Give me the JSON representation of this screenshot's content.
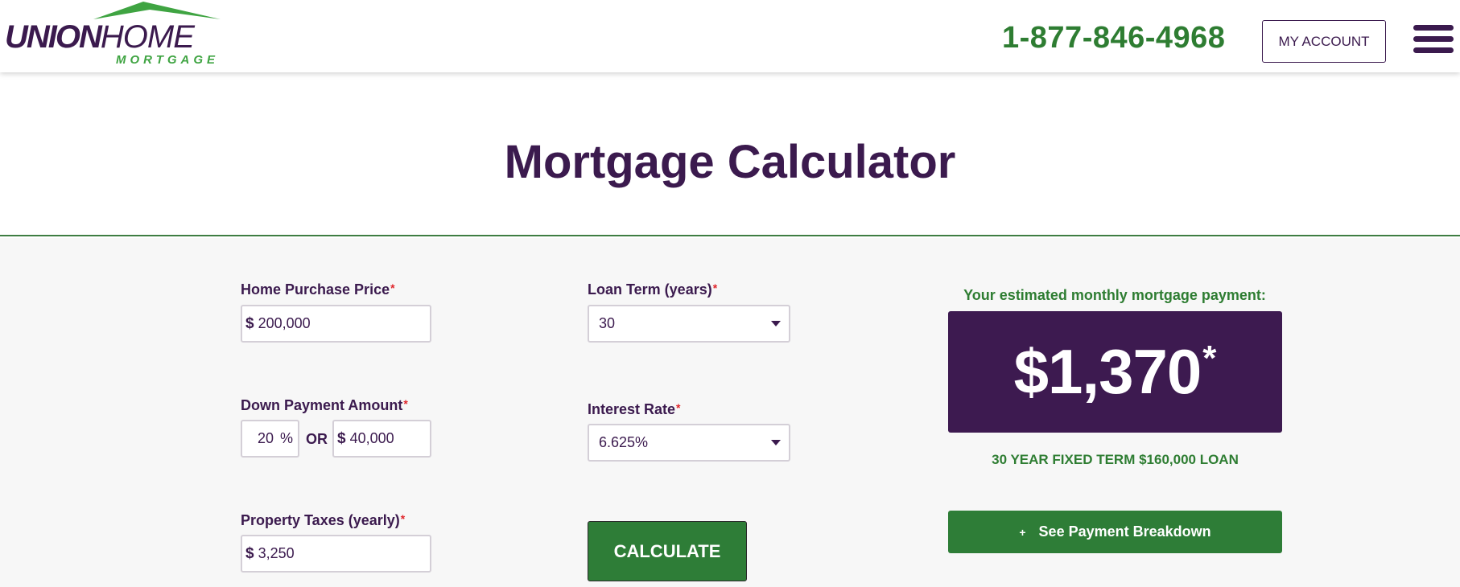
{
  "header": {
    "logo": {
      "word1": "UNION",
      "word2": "HOME",
      "tagline": "MORTGAGE",
      "roof_color": "#3fa442"
    },
    "phone": "1-877-846-4968",
    "account_button": "MY ACCOUNT",
    "menu_icon": "hamburger-icon"
  },
  "page": {
    "title": "Mortgage Calculator"
  },
  "form": {
    "home_price": {
      "label": "Home Purchase Price",
      "required": "*",
      "prefix": "$",
      "value": "200,000"
    },
    "down_payment": {
      "label": "Down Payment Amount",
      "required": "*",
      "percent_value": "20",
      "percent_suffix": "%",
      "or_label": "OR",
      "prefix": "$",
      "amount_value": "40,000"
    },
    "property_taxes": {
      "label": "Property Taxes (yearly)",
      "required": "*",
      "prefix": "$",
      "value": "3,250"
    },
    "loan_term": {
      "label": "Loan Term (years)",
      "required": "*",
      "selected": "30"
    },
    "interest_rate": {
      "label": "Interest Rate",
      "required": "*",
      "selected": "6.625%"
    },
    "calculate_button": "CALCULATE"
  },
  "result": {
    "caption": "Your estimated monthly mortgage payment:",
    "amount": "$1,370",
    "asterisk": "*",
    "summary": "30 YEAR FIXED TERM $160,000 LOAN",
    "breakdown_button": {
      "icon": "+",
      "label": "See Payment Breakdown"
    }
  },
  "colors": {
    "brand_purple": "#3b1a4e",
    "brand_green": "#2e7d37",
    "required_red": "#e0242a",
    "result_box": "#3d1a50"
  }
}
